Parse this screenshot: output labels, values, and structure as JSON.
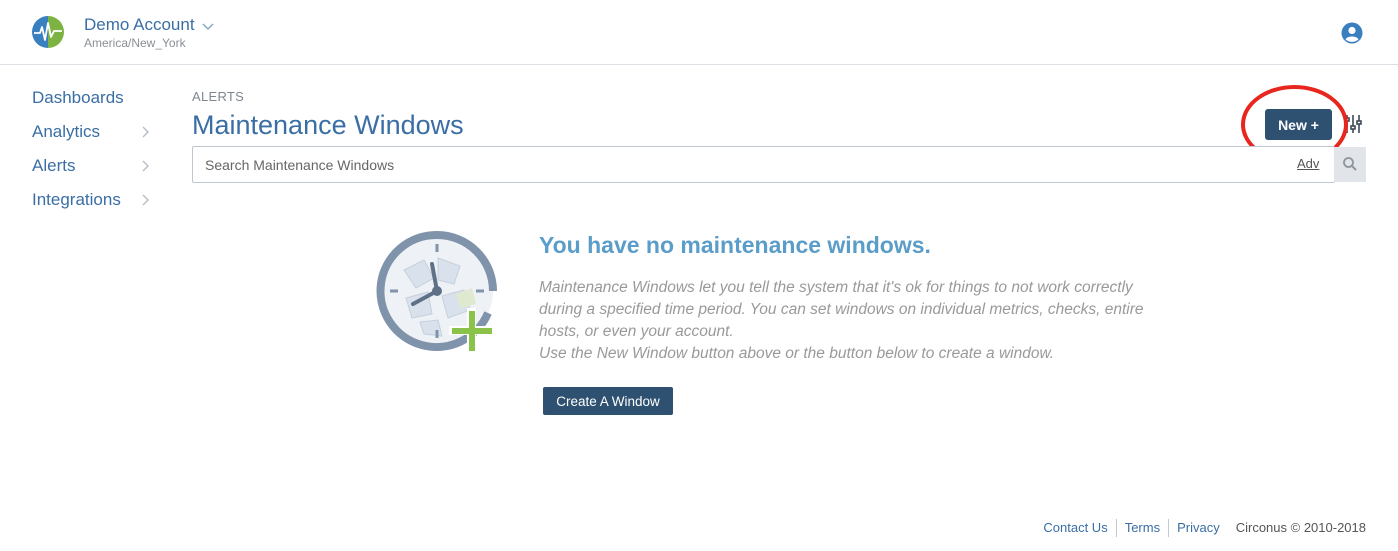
{
  "header": {
    "account_name": "Demo Account",
    "account_timezone": "America/New_York",
    "logo_icon": "circonus-logo",
    "user_icon": "user-circle-icon"
  },
  "sidebar": {
    "items": [
      {
        "label": "Dashboards",
        "has_submenu": false
      },
      {
        "label": "Analytics",
        "has_submenu": true
      },
      {
        "label": "Alerts",
        "has_submenu": true
      },
      {
        "label": "Integrations",
        "has_submenu": true
      }
    ]
  },
  "main": {
    "breadcrumb": "ALERTS",
    "title": "Maintenance Windows",
    "new_button_label": "New +",
    "search": {
      "placeholder": "Search Maintenance Windows",
      "value": "",
      "adv_label": "Adv"
    }
  },
  "empty_state": {
    "title": "You have no maintenance windows.",
    "description_lines": [
      "Maintenance Windows let you tell the system that it's ok for things to not work correctly",
      "during a specified time period. You can set windows on individual metrics, checks, entire",
      "hosts, or even your account.",
      "Use the New Window button above or the button below to create a window."
    ],
    "create_button_label": "Create A Window"
  },
  "footer": {
    "links": [
      "Contact Us",
      "Terms",
      "Privacy"
    ],
    "copyright": "Circonus © 2010-2018"
  },
  "colors": {
    "accent": "#3a6ea5",
    "button": "#2f5171",
    "empty_title": "#5b9dc9",
    "annotation": "#e8261d",
    "plus": "#8bc34a"
  }
}
